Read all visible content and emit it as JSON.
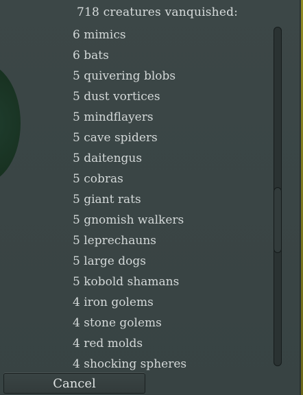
{
  "header": {
    "title": "718 creatures vanquished:"
  },
  "creatures": [
    "6 mimics",
    "6 bats",
    "5 quivering blobs",
    "5 dust vortices",
    "5 mindflayers",
    "5 cave spiders",
    "5 daitengus",
    "5 cobras",
    "5 giant rats",
    "5 gnomish walkers",
    "5 leprechauns",
    "5 large dogs",
    "5 kobold shamans",
    "4 iron golems",
    "4 stone golems",
    "4 red molds",
    "4 shocking spheres"
  ],
  "footer": {
    "cancel_label": "Cancel"
  },
  "colors": {
    "background": "#3a4545",
    "text": "#d4d9d9",
    "accent_edge": "#8f8a22",
    "creature_shape": "#1f3d2e"
  }
}
